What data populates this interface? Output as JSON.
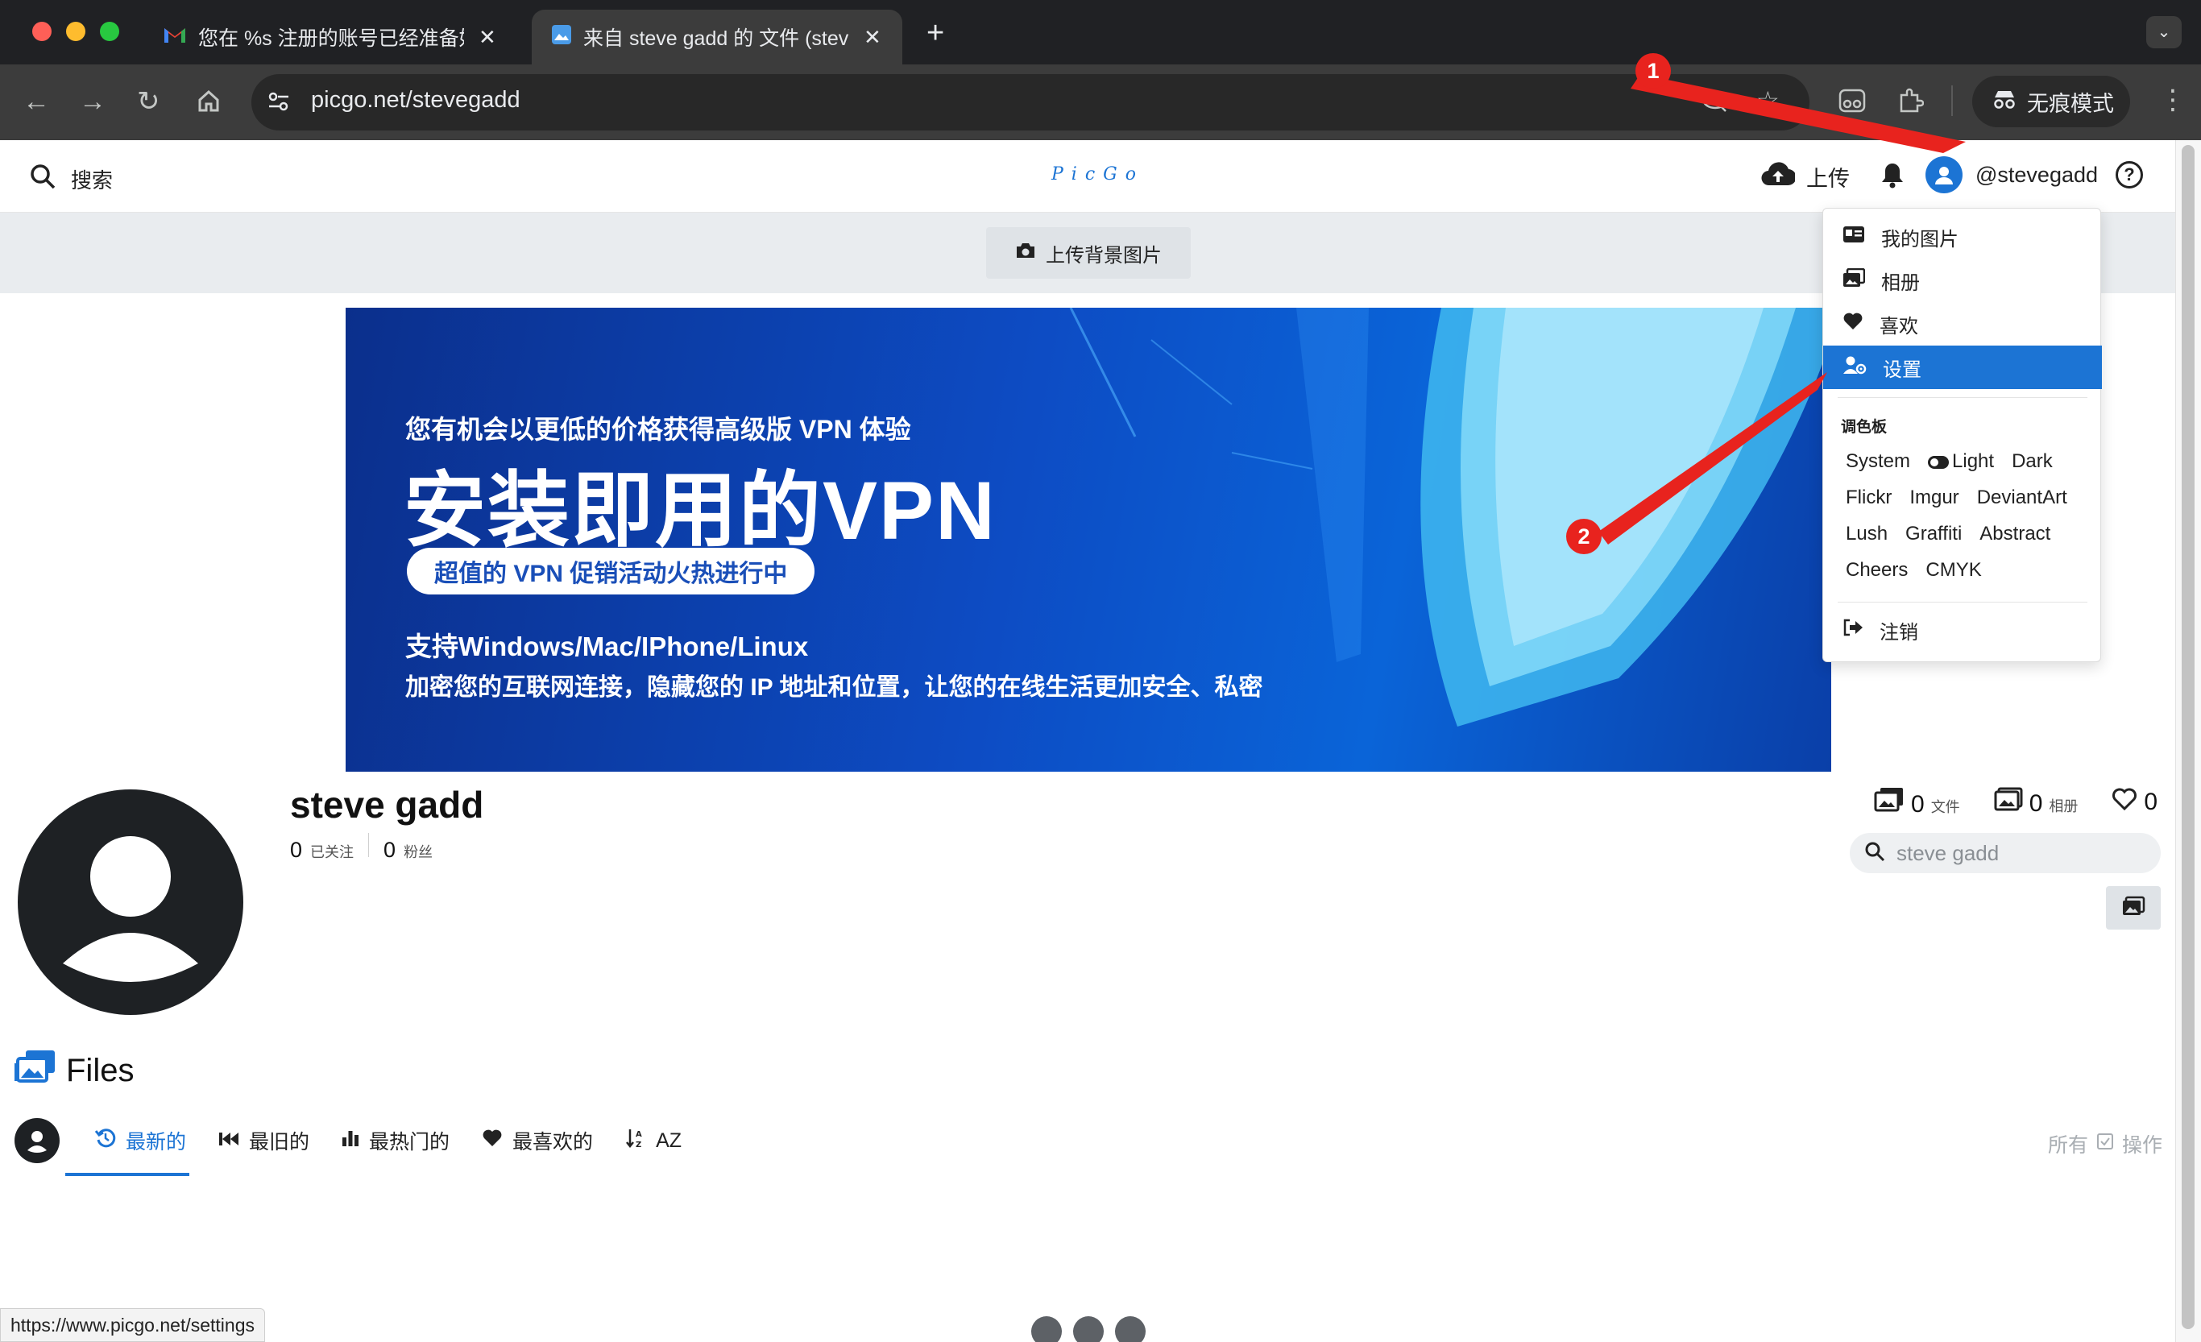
{
  "browser": {
    "tabs": [
      {
        "title": "您在 %s 注册的账号已经准备好了",
        "close": "✕"
      },
      {
        "title": "来自 steve gadd 的 文件 (steve gadd)",
        "close": "✕"
      }
    ],
    "new_tab": "+",
    "url": "picgo.net/stevegadd",
    "incognito_label": "无痕模式",
    "status_url": "https://www.picgo.net/settings"
  },
  "header": {
    "search_label": "搜索",
    "logo": "PicGo",
    "upload_label": "上传",
    "username": "@stevegadd",
    "help": "?"
  },
  "cover": {
    "upload_bg_label": "上传背景图片"
  },
  "banner": {
    "subtitle": "您有机会以更低的价格获得高级版 VPN 体验",
    "title": "安装即用的VPN",
    "pill": "超值的 VPN 促销活动火热进行中",
    "line1": "支持Windows/Mac/IPhone/Linux",
    "line2": "加密您的互联网连接，隐藏您的 IP 地址和位置，让您的在线生活更加安全、私密"
  },
  "profile": {
    "name": "steve gadd",
    "following_count": "0",
    "following_label": "已关注",
    "followers_count": "0",
    "followers_label": "粉丝",
    "files_count": "0",
    "files_label": "文件",
    "albums_count": "0",
    "albums_label": "相册",
    "likes_count": "0",
    "search_placeholder": "steve gadd"
  },
  "files": {
    "title": "Files",
    "sort": [
      "最新的",
      "最旧的",
      "最热门的",
      "最喜欢的",
      "AZ"
    ],
    "all_label": "所有",
    "ops_label": "操作"
  },
  "dropdown": {
    "items": [
      "我的图片",
      "相册",
      "喜欢",
      "设置"
    ],
    "palette_label": "调色板",
    "palette_rows": [
      [
        "System",
        "Light",
        "Dark"
      ],
      [
        "Flickr",
        "Imgur",
        "DeviantArt"
      ],
      [
        "Lush",
        "Graffiti",
        "Abstract"
      ],
      [
        "Cheers",
        "CMYK"
      ]
    ],
    "logout": "注销"
  },
  "annotations": {
    "badge1": "1",
    "badge2": "2"
  },
  "colors": {
    "accent": "#1c74d4",
    "annotation": "#e8231e",
    "chrome": "#202124"
  }
}
